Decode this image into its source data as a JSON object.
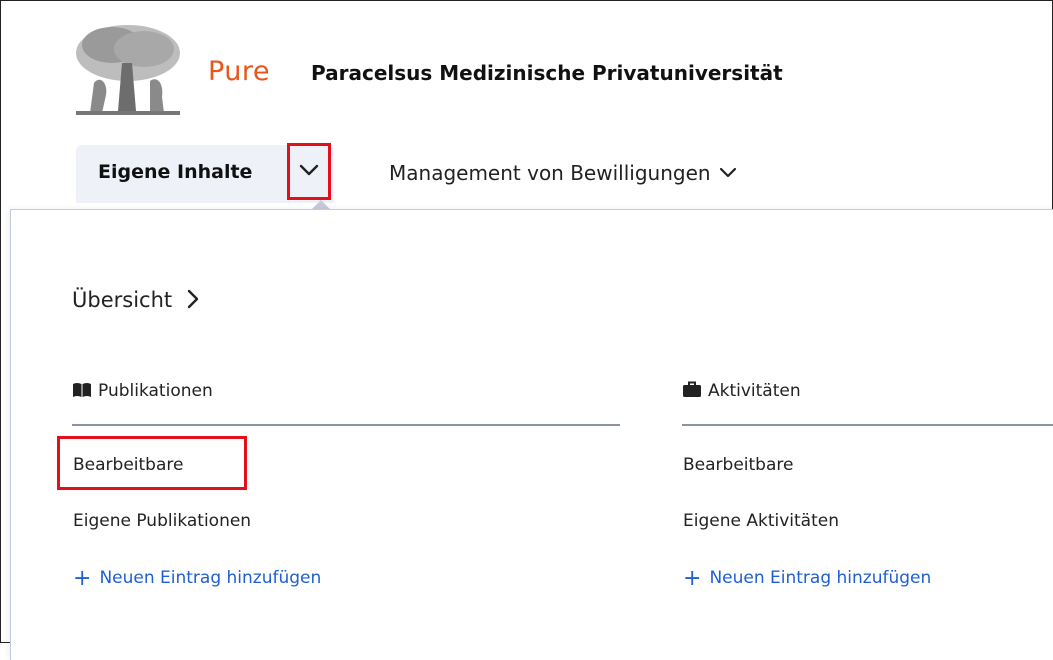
{
  "header": {
    "brand": "Pure",
    "organization": "Paracelsus Medizinische Privatuniversität",
    "logo_icon": "elsevier-tree-logo"
  },
  "nav": {
    "tabs": [
      {
        "label": "Eigene Inhalte",
        "icon": "chevron-down-icon",
        "active": true
      },
      {
        "label": "Management von Bewilligungen",
        "icon": "chevron-down-icon",
        "active": false
      }
    ]
  },
  "dropdown": {
    "overview": {
      "label": "Übersicht",
      "icon": "chevron-right-icon"
    },
    "sections": [
      {
        "title": "Publikationen",
        "icon": "book-icon",
        "items": [
          "Bearbeitbare",
          "Eigene Publikationen"
        ],
        "add_label": "Neuen Eintrag hinzufügen"
      },
      {
        "title": "Aktivitäten",
        "icon": "briefcase-icon",
        "items": [
          "Bearbeitbare",
          "Eigene Aktivitäten"
        ],
        "add_label": "Neuen Eintrag hinzufügen"
      }
    ]
  },
  "colors": {
    "brand": "#e9561c",
    "link": "#1f5fd1",
    "highlight": "#e3101c",
    "active_tab_bg": "#eef1f7"
  }
}
